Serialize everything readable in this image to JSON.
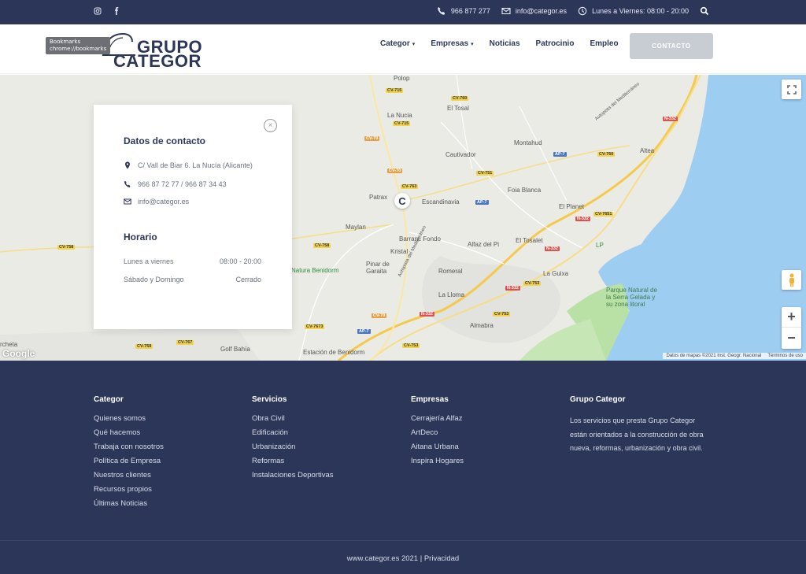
{
  "topbar": {
    "social": [
      "instagram-icon",
      "facebook-icon"
    ],
    "phone": "966 877 277",
    "email": "info@categor.es",
    "hours": "Lunes a Viernes: 08:00 - 20:00"
  },
  "header": {
    "tooltip_line1": "Bookmarks",
    "tooltip_line2": "chrome://bookmarks",
    "logo_line1": "GRUPO",
    "logo_line2": "CATEGOR",
    "nav": [
      {
        "label": "Categor",
        "dropdown": true
      },
      {
        "label": "Empresas",
        "dropdown": true
      },
      {
        "label": "Noticias",
        "dropdown": false
      },
      {
        "label": "Patrocinio",
        "dropdown": false
      },
      {
        "label": "Empleo",
        "dropdown": false
      }
    ],
    "contact_button": "CONTACTO"
  },
  "map": {
    "places": [
      "Polop",
      "El Tosal",
      "La Nucia",
      "Cautivador",
      "Montahud",
      "Altea",
      "Foia Blanca",
      "Patrax",
      "Escandinavia",
      "El Planet",
      "Maylan",
      "Barranc Fondo",
      "El Tosalet",
      "LP",
      "Kristal",
      "Alfaz del Pi",
      "Pinar de Garaita",
      "Romeral",
      "La Guixa",
      "Natura Benidorm",
      "La Lloma",
      "Almabra",
      "Parque Natural de la Serra Gelada y su zona litoral",
      "Golf Bahía",
      "Estación de Benidorm",
      "rcheta",
      "Autopista del Mediterráneo"
    ],
    "roads": [
      "CV-715",
      "CV-760",
      "CV-70",
      "AP-7",
      "N-332",
      "CV-751",
      "CV-763",
      "CV-7651",
      "CV-758",
      "CV-753",
      "CV-7673",
      "CV-759",
      "CV-767"
    ],
    "google": "Google",
    "attribution": "Datos de mapas ©2021 Inst. Geogr. Nacional",
    "terms": "Términos de uso",
    "pin_letter": "C"
  },
  "contact_card": {
    "title": "Datos de contacto",
    "address": "C/ Vall de Biar 6. La Nucía (Alicante)",
    "phones": "966 87 72 77 / 966 87 34 43",
    "email": "info@categor.es",
    "hours_title": "Horario",
    "hours": [
      {
        "day": "Lunes a viernes",
        "time": "08:00 - 20:00"
      },
      {
        "day": "Sábado y Domingo",
        "time": "Cerrado"
      }
    ]
  },
  "footer": {
    "columns": [
      {
        "title": "Categor",
        "items": [
          "Quienes somos",
          "Qué hacemos",
          "Trabaja con nosotros",
          "Política de Empresa",
          "Nuestros clientes",
          "Recursos propios",
          "Últimas Noticias"
        ]
      },
      {
        "title": "Servicios",
        "items": [
          "Obra Civil",
          "Edificación",
          "Urbanización",
          "Reformas",
          "Instalaciones Deportivas"
        ]
      },
      {
        "title": "Empresas",
        "items": [
          "Cerrajería Alfaz",
          "ArtDeco",
          "Aitana Urbana",
          "Inspira Hogares"
        ]
      },
      {
        "title": "Grupo Categor",
        "text": "Los servicios que presta Grupo Categor están orientados a la construcción de obra nueva, reformas, urbanización y obra civil."
      }
    ],
    "copyright": "www.categor.es 2021 | Privacidad"
  },
  "colors": {
    "navy": "#2c3659",
    "sea": "#9ecdf2",
    "park": "#b9e0a5"
  }
}
